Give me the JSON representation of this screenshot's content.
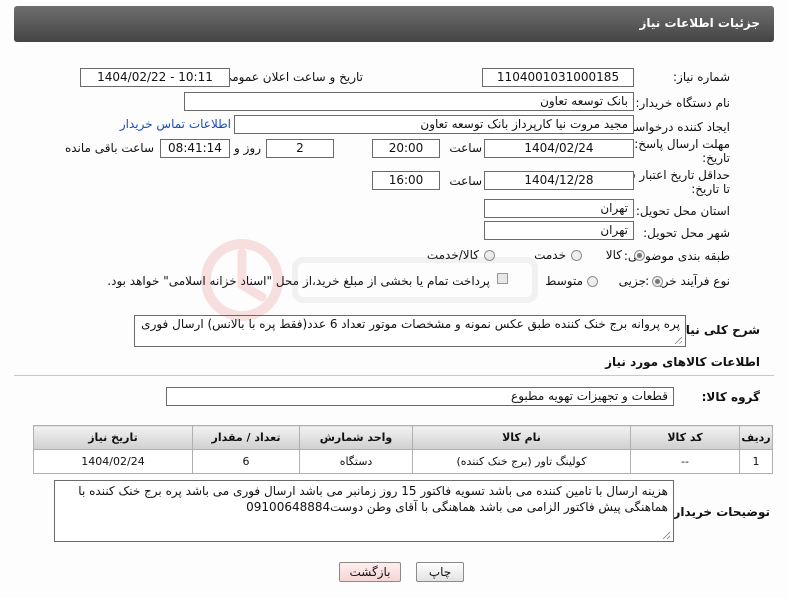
{
  "header": {
    "title": "جزئیات اطلاعات نیاز"
  },
  "fields": {
    "need_number": {
      "label": "شماره نیاز:",
      "value": "1104001031000185"
    },
    "announce_datetime": {
      "label": "تاریخ و ساعت اعلان عمومی:",
      "value": "1404/02/22 - 10:11"
    },
    "buyer_org": {
      "label": "نام دستگاه خریدار:",
      "value": "بانک توسعه تعاون"
    },
    "requester": {
      "label": "ایجاد کننده درخواست:",
      "value": "مجید مروت نیا کارپرداز بانک توسعه تعاون",
      "contact_link": "اطلاعات تماس خریدار"
    },
    "response_deadline": {
      "label_line1": "مهلت ارسال پاسخ: تا",
      "label_line2": "تاریخ:",
      "date": "1404/02/24",
      "time_label": "ساعت",
      "time": "20:00",
      "days": "2",
      "days_label": "روز و",
      "remaining": "08:41:14",
      "remaining_label": "ساعت باقی مانده"
    },
    "price_validity": {
      "label_line1": "حداقل تاریخ اعتبار قیمت:",
      "label_line2": "تا تاریخ:",
      "date": "1404/12/28",
      "time_label": "ساعت",
      "time": "16:00"
    },
    "delivery_province": {
      "label": "استان محل تحویل:",
      "value": "تهران"
    },
    "delivery_city": {
      "label": "شهر محل تحویل:",
      "value": "تهران"
    },
    "category": {
      "label": "طبقه بندی موضوعی:",
      "options": [
        "کالا",
        "خدمت",
        "کالا/خدمت"
      ],
      "selected": "کالا"
    },
    "process": {
      "label": "نوع فرآیند خرید :",
      "options": [
        "جزیی",
        "متوسط"
      ],
      "selected": "جزیی",
      "checkbox_text": "پرداخت تمام یا بخشی از مبلغ خرید،از محل \"اسناد خزانه اسلامی\" خواهد بود."
    },
    "general_description": {
      "label": "شرح کلی نیاز:",
      "value": "پره پروانه برج خنک کننده طبق عکس نمونه و مشخصات موتور تعداد 6 عدد(فقط پره با بالانس) ارسال فوری"
    }
  },
  "goods_section": {
    "title": "اطلاعات کالاهای مورد نیاز",
    "group_label": "گروه کالا:",
    "group_value": "قطعات و تجهیزات تهویه مطبوع"
  },
  "table": {
    "headers": [
      "ردیف",
      "کد کالا",
      "نام کالا",
      "واحد شمارش",
      "تعداد / مقدار",
      "تاریخ نیاز"
    ],
    "rows": [
      [
        "1",
        "--",
        "کولینگ تاور (برج خنک کننده)",
        "دستگاه",
        "6",
        "1404/02/24"
      ]
    ]
  },
  "buyer_notes": {
    "label": "توضیحات خریدار:",
    "value": "هزینه ارسال با تامین کننده می باشد تسویه فاکتور 15 روز زمانبر می باشد ارسال فوری می باشد پره برج خنک کننده با هماهنگی پیش فاکتور الزامی می باشد هماهنگی با آقای وطن دوست09100648884"
  },
  "buttons": {
    "print": "چاپ",
    "back": "بازگشت"
  },
  "colors": {
    "header_bg": "#555555",
    "link": "#1b4fb4",
    "back_button_bg": "#fde4e4"
  },
  "watermark_icon": "watermark-logo-icon"
}
